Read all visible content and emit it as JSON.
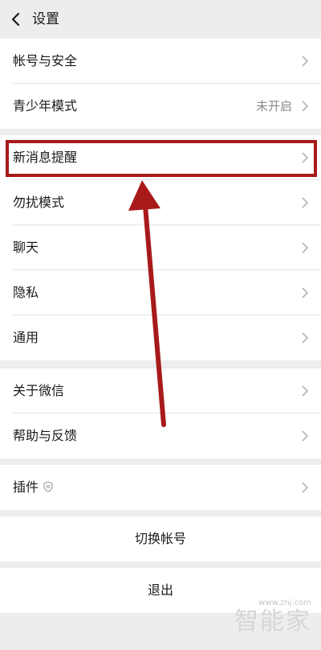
{
  "header": {
    "title": "设置",
    "back_icon": "chevron-left-icon"
  },
  "groups": {
    "account": [
      {
        "label": "帐号与安全"
      },
      {
        "label": "青少年模式",
        "value": "未开启"
      }
    ],
    "notify": [
      {
        "label": "新消息提醒"
      },
      {
        "label": "勿扰模式"
      },
      {
        "label": "聊天"
      },
      {
        "label": "隐私"
      },
      {
        "label": "通用"
      }
    ],
    "about": [
      {
        "label": "关于微信"
      },
      {
        "label": "帮助与反馈"
      }
    ],
    "plugins": [
      {
        "label": "插件",
        "icon": "shield-icon"
      }
    ]
  },
  "actions": {
    "switch_account": "切换帐号",
    "logout": "退出"
  },
  "annotation": {
    "highlight_color": "#a81a1a",
    "highlighted_item": "新消息提醒"
  },
  "watermark": {
    "url": "www.znj.com",
    "text": "智能家"
  }
}
